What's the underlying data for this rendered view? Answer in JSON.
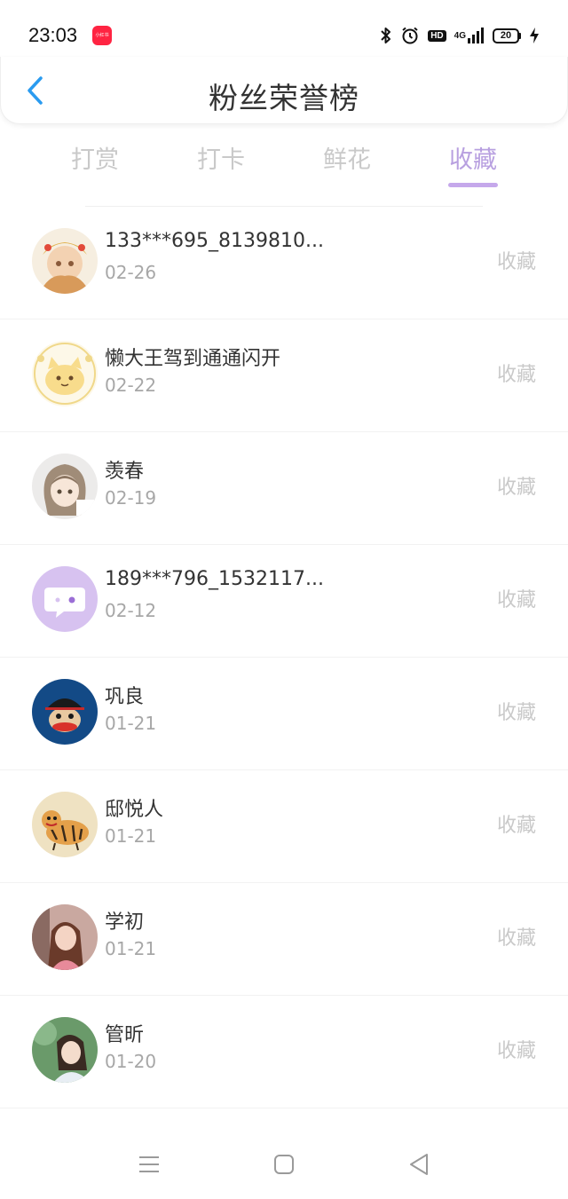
{
  "status": {
    "time": "23:03",
    "app_badge": "小红书",
    "hd": "HD",
    "network": "4G",
    "battery": "20"
  },
  "header": {
    "title": "粉丝荣誉榜"
  },
  "tabs": [
    {
      "label": "打赏",
      "active": false
    },
    {
      "label": "打卡",
      "active": false
    },
    {
      "label": "鲜花",
      "active": false
    },
    {
      "label": "收藏",
      "active": true
    }
  ],
  "fans": [
    {
      "name": "133***695_8139810...",
      "date": "02-26",
      "type": "收藏",
      "avatar": "anime-girl-golden"
    },
    {
      "name": "懒大王驾到通通闪开",
      "date": "02-22",
      "type": "收藏",
      "avatar": "cartoon-cat-yellow"
    },
    {
      "name": "羡春",
      "date": "02-19",
      "type": "收藏",
      "avatar": "anime-girl-brown-hair"
    },
    {
      "name": "189***796_1532117...",
      "date": "02-12",
      "type": "收藏",
      "avatar": "default-chat-bubble"
    },
    {
      "name": "巩良",
      "date": "01-21",
      "type": "收藏",
      "avatar": "monkey-blue"
    },
    {
      "name": "邸悦人",
      "date": "01-21",
      "type": "收藏",
      "avatar": "tiger-drawing"
    },
    {
      "name": "学初",
      "date": "01-21",
      "type": "收藏",
      "avatar": "girl-photo-pink"
    },
    {
      "name": "管昕",
      "date": "01-20",
      "type": "收藏",
      "avatar": "girl-photo-green"
    }
  ],
  "colors": {
    "accent": "#c5a8eb",
    "back_arrow": "#2a9bf0",
    "inactive": "#c9c9c9"
  }
}
